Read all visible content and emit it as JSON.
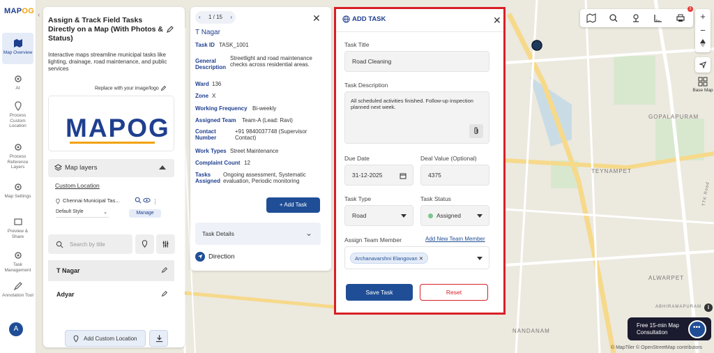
{
  "app": {
    "logo_main": "MAP",
    "logo_accent": "OG"
  },
  "rail": {
    "items": [
      {
        "label": "Map Overview"
      },
      {
        "label": "AI"
      },
      {
        "label": "Process Custom Location"
      },
      {
        "label": "Process Reference Layers"
      },
      {
        "label": "Map Settings"
      },
      {
        "label": "Preview & Share"
      },
      {
        "label": "Task Management"
      },
      {
        "label": "Annotation Tool"
      }
    ],
    "avatar": "A"
  },
  "panel1": {
    "title": "Assign & Track Field Tasks Directly on a Map (With Photos & Status)",
    "description": "Interactive maps streamline municipal tasks like lighting, drainage, road maintenance, and public services",
    "replace_logo": "Replace with your image/logo",
    "logo_text_main": "MAP",
    "logo_text_accent": "OG",
    "layers_title": "Map layers",
    "custom_location": "Custom Location",
    "layer_name": "Chennai Municipal Tas...",
    "style_select": "Default Style",
    "manage_label": "Manage",
    "search_placeholder": "Search by title",
    "list": [
      {
        "name": "T Nagar"
      },
      {
        "name": "Adyar"
      }
    ],
    "add_custom_location": "Add Custom Location"
  },
  "panel2": {
    "pager": "1 / 15",
    "name": "T Nagar",
    "fields": [
      {
        "k": "Task ID",
        "v": "TASK_1001"
      },
      {
        "k": "General Description",
        "v": "Streetlight and road maintenance checks across residential areas."
      },
      {
        "k": "Ward",
        "v": "136"
      },
      {
        "k": "Zone",
        "v": "X"
      },
      {
        "k": "Working Frequency",
        "v": "Bi-weekly"
      },
      {
        "k": "Assigned Team",
        "v": "Team-A (Lead: Ravi)"
      },
      {
        "k": "Contact Number",
        "v": "+91 9840037748 (Supervisor Contact)"
      },
      {
        "k": "Work Types",
        "v": "Street Maintenance"
      },
      {
        "k": "Complaint Count",
        "v": "12"
      },
      {
        "k": "Tasks Assigned",
        "v": "Ongoing assessment, Systematic evaluation, Periodic monitoring"
      }
    ],
    "add_task": "+ Add Task",
    "task_details": "Task Details",
    "direction": "Direction"
  },
  "panel3": {
    "title": "ADD TASK",
    "task_title_label": "Task Title",
    "task_title_value": "Road Cleaning",
    "task_desc_label": "Task Description",
    "task_desc_value": "All scheduled activities finished. Follow-up inspection planned next week.",
    "due_date_label": "Due Date",
    "due_date_value": "31-12-2025",
    "deal_value_label": "Deal Value (Optional)",
    "deal_value_value": "4375",
    "task_type_label": "Task Type",
    "task_type_value": "Road",
    "task_status_label": "Task Status",
    "task_status_value": "Assigned",
    "assign_label": "Assign Team Member",
    "add_member_link": "Add New Team Member",
    "member_chip": "Archanavarshni Elangovan",
    "save": "Save Task",
    "reset": "Reset"
  },
  "map": {
    "labels": {
      "gopalapuram": "GOPALAPURAM",
      "teynampet": "TEYNAMPET",
      "alwarpet": "ALWARPET",
      "nandanam": "NANDANAM",
      "ttk_road": "TTK Road",
      "abhiramapuram": "ABHIRAMAPURAM"
    },
    "base_map": "Base Map",
    "notification_count": "5",
    "consult_line1": "Free 15-min Map",
    "consult_line2": "Consultation",
    "attribution": "© MapTiler © OpenStreetMap contributors"
  },
  "colors": {
    "brand": "#1f4e96",
    "accent": "#f2a10a",
    "highlight": "#d81f26",
    "status_assigned": "#7cc68e"
  }
}
